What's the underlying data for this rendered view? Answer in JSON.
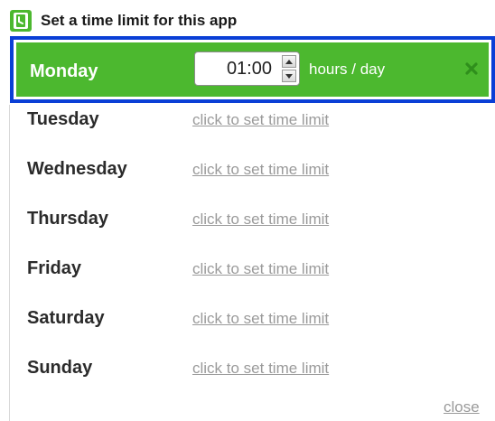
{
  "header": {
    "title": "Set a time limit for this app",
    "icon": "clock-icon"
  },
  "colors": {
    "selected_row": "#4cb82f",
    "selection_border": "#0a3fd6",
    "link": "#9a9a9a"
  },
  "selected_day": {
    "name": "Monday",
    "time_value": "01:00",
    "unit": "hours / day",
    "clear_icon": "close-x-icon"
  },
  "days": [
    {
      "name": "Tuesday",
      "link": "click to set time limit"
    },
    {
      "name": "Wednesday",
      "link": "click to set time limit"
    },
    {
      "name": "Thursday",
      "link": "click to set time limit"
    },
    {
      "name": "Friday",
      "link": "click to set time limit"
    },
    {
      "name": "Saturday",
      "link": "click to set time limit"
    },
    {
      "name": "Sunday",
      "link": "click to set time limit"
    }
  ],
  "footer": {
    "close_label": "close"
  }
}
